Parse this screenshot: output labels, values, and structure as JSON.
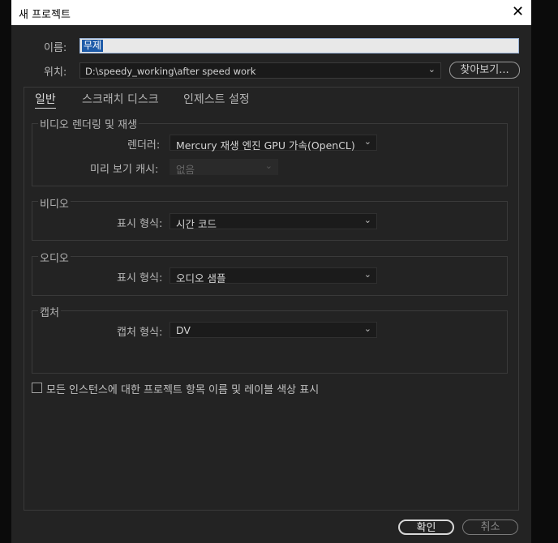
{
  "window": {
    "title": "새 프로젝트",
    "close_glyph": "✕"
  },
  "name": {
    "label": "이름:",
    "value": "무제"
  },
  "location": {
    "label": "위치:",
    "value": "D:\\speedy_working\\after speed work",
    "browse_label": "찾아보기..."
  },
  "tabs": [
    {
      "label": "일반",
      "active": true
    },
    {
      "label": "스크래치 디스크",
      "active": false
    },
    {
      "label": "인제스트 설정",
      "active": false
    }
  ],
  "video_rendering": {
    "title": "비디오 렌더링 및 재생",
    "renderer_label": "렌더러:",
    "renderer_value": "Mercury 재생 엔진 GPU 가속(OpenCL)",
    "preview_cache_label": "미리 보기 캐시:",
    "preview_cache_value": "없음"
  },
  "video": {
    "title": "비디오",
    "format_label": "표시 형식:",
    "format_value": "시간 코드"
  },
  "audio": {
    "title": "오디오",
    "format_label": "표시 형식:",
    "format_value": "오디오 샘플"
  },
  "capture": {
    "title": "캡처",
    "format_label": "캡처 형식:",
    "format_value": "DV"
  },
  "checkbox_label": "모든 인스턴스에 대한 프로젝트 항목 이름 및 레이블 색상 표시",
  "buttons": {
    "ok": "확인",
    "cancel": "취소"
  },
  "icons": {
    "dropdown": "chevron-down-icon",
    "close": "close-icon"
  }
}
